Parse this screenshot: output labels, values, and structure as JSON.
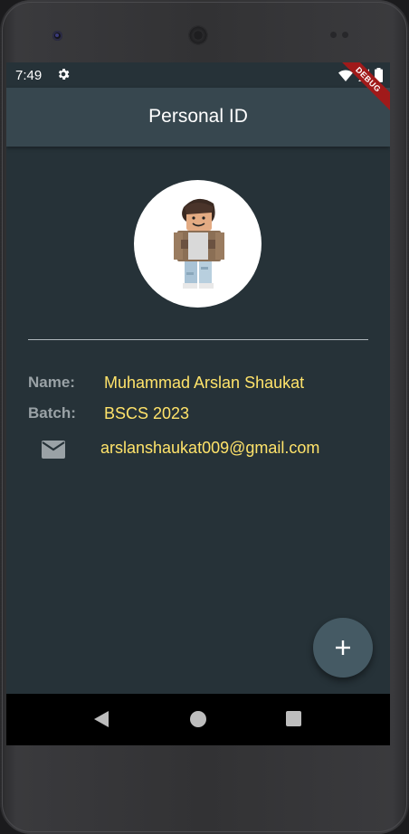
{
  "status_bar": {
    "time": "7:49",
    "icons": [
      "gear-icon",
      "wifi-icon",
      "signal-icon",
      "battery-icon"
    ]
  },
  "debug_banner": "DEBUG",
  "app_bar": {
    "title": "Personal ID"
  },
  "profile": {
    "avatar": "avatar-image",
    "name_label": "Name:",
    "name_value": "Muhammad Arslan Shaukat",
    "batch_label": "Batch:",
    "batch_value": "BSCS 2023",
    "email_icon": "mail-icon",
    "email_value": "arslanshaukat009@gmail.com"
  },
  "fab": {
    "icon": "plus-icon",
    "label": "+"
  },
  "nav": {
    "back": "back-icon",
    "home": "home-icon",
    "recents": "recents-icon"
  },
  "colors": {
    "background": "#263238",
    "app_bar": "#37474F",
    "accent_text": "#FFE36A",
    "label_text": "#9AA2A6",
    "fab": "#455A64"
  }
}
